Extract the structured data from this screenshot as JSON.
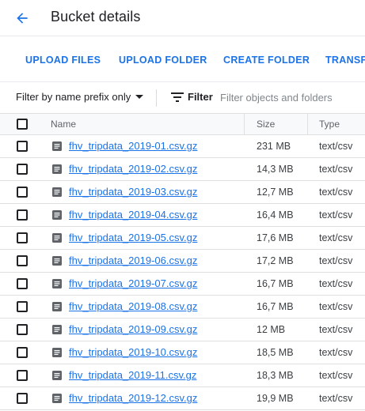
{
  "header": {
    "title": "Bucket details",
    "back_icon": "arrow-back-icon"
  },
  "colors": {
    "accent": "#1a73e8",
    "text": "#202124",
    "muted": "#5f6368",
    "divider": "#e0e0e0"
  },
  "toolbar": {
    "upload_files": "UPLOAD FILES",
    "upload_folder": "UPLOAD FOLDER",
    "create_folder": "CREATE FOLDER",
    "transfer": "TRANSF"
  },
  "filterbar": {
    "prefix_option": "Filter by name prefix only",
    "filter_label": "Filter",
    "filter_placeholder": "Filter objects and folders"
  },
  "table": {
    "columns": {
      "name": "Name",
      "size": "Size",
      "type": "Type"
    },
    "rows": [
      {
        "name": "fhv_tripdata_2019-01.csv.gz",
        "size": "231 MB",
        "type": "text/csv"
      },
      {
        "name": "fhv_tripdata_2019-02.csv.gz",
        "size": "14,3 MB",
        "type": "text/csv"
      },
      {
        "name": "fhv_tripdata_2019-03.csv.gz",
        "size": "12,7 MB",
        "type": "text/csv"
      },
      {
        "name": "fhv_tripdata_2019-04.csv.gz",
        "size": "16,4 MB",
        "type": "text/csv"
      },
      {
        "name": "fhv_tripdata_2019-05.csv.gz",
        "size": "17,6 MB",
        "type": "text/csv"
      },
      {
        "name": "fhv_tripdata_2019-06.csv.gz",
        "size": "17,2 MB",
        "type": "text/csv"
      },
      {
        "name": "fhv_tripdata_2019-07.csv.gz",
        "size": "16,7 MB",
        "type": "text/csv"
      },
      {
        "name": "fhv_tripdata_2019-08.csv.gz",
        "size": "16,7 MB",
        "type": "text/csv"
      },
      {
        "name": "fhv_tripdata_2019-09.csv.gz",
        "size": "12 MB",
        "type": "text/csv"
      },
      {
        "name": "fhv_tripdata_2019-10.csv.gz",
        "size": "18,5 MB",
        "type": "text/csv"
      },
      {
        "name": "fhv_tripdata_2019-11.csv.gz",
        "size": "18,3 MB",
        "type": "text/csv"
      },
      {
        "name": "fhv_tripdata_2019-12.csv.gz",
        "size": "19,9 MB",
        "type": "text/csv"
      }
    ]
  }
}
